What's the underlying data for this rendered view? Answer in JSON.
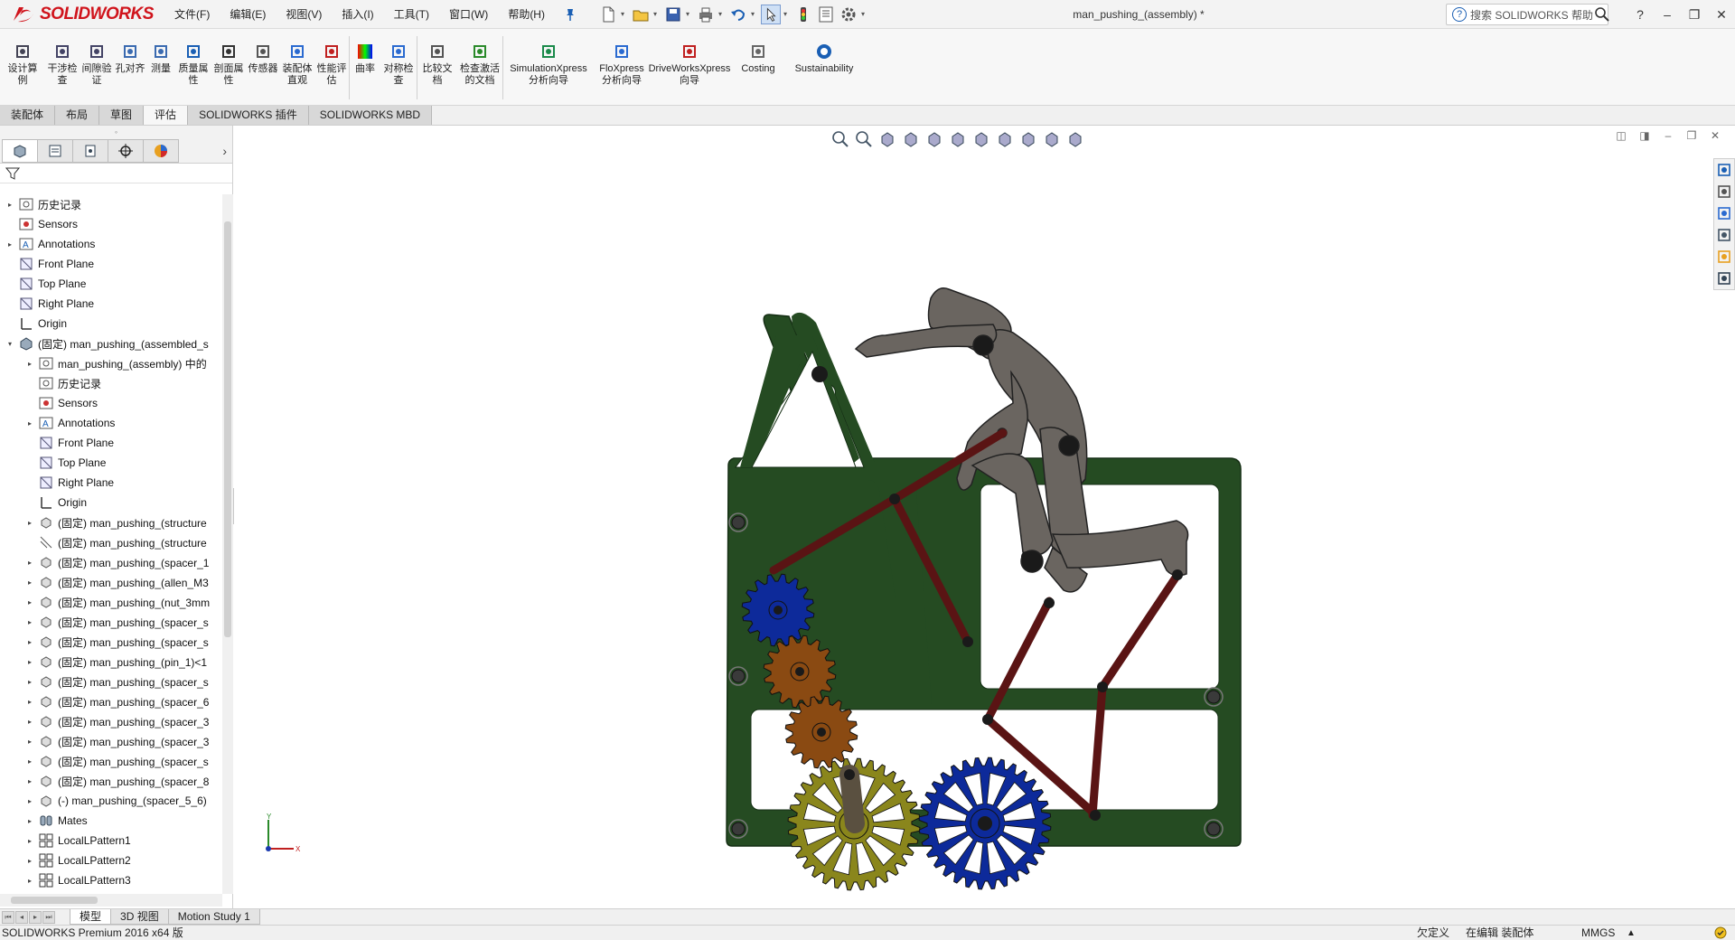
{
  "app": {
    "logo_text": "SOLIDWORKS",
    "document_title": "man_pushing_(assembly) *",
    "search_placeholder": "搜索 SOLIDWORKS 帮助"
  },
  "menu": [
    {
      "id": "file",
      "label": "文件(F)"
    },
    {
      "id": "edit",
      "label": "编辑(E)"
    },
    {
      "id": "view",
      "label": "视图(V)"
    },
    {
      "id": "insert",
      "label": "插入(I)"
    },
    {
      "id": "tools",
      "label": "工具(T)"
    },
    {
      "id": "window",
      "label": "窗口(W)"
    },
    {
      "id": "help",
      "label": "帮助(H)"
    }
  ],
  "quick_tools": [
    "new-file-icon",
    "open-file-icon",
    "save-icon",
    "print-icon",
    "undo-icon",
    "select-arrow-icon",
    "rebuild-icon",
    "file-properties-icon",
    "options-icon"
  ],
  "window_buttons": {
    "help": "?",
    "minimize": "–",
    "restore": "❐",
    "close": "✕"
  },
  "commands": [
    {
      "id": "design-study",
      "label": "设计算\n例",
      "icon": "design-study-icon"
    },
    {
      "id": "interference",
      "label": "干涉检\n查",
      "icon": "interference-icon"
    },
    {
      "id": "clearance",
      "label": "间隙验\n证",
      "icon": "clearance-icon"
    },
    {
      "id": "hole-align",
      "label": "孔对齐",
      "icon": "hole-align-icon"
    },
    {
      "id": "measure",
      "label": "测量",
      "icon": "measure-icon"
    },
    {
      "id": "mass-props",
      "label": "质量属\n性",
      "icon": "mass-properties-icon"
    },
    {
      "id": "section-props",
      "label": "剖面属\n性",
      "icon": "section-properties-icon"
    },
    {
      "id": "sensor",
      "label": "传感器",
      "icon": "sensor-icon"
    },
    {
      "id": "assembly-visual",
      "label": "装配体\n直观",
      "icon": "assembly-visualization-icon"
    },
    {
      "id": "performance",
      "label": "性能评\n估",
      "icon": "performance-icon"
    },
    {
      "id": "curvature",
      "label": "曲率",
      "icon": "curvature-icon"
    },
    {
      "id": "symmetry",
      "label": "对称检\n查",
      "icon": "symmetry-icon"
    },
    {
      "id": "compare",
      "label": "比较文\n档",
      "icon": "compare-icon"
    },
    {
      "id": "check-active",
      "label": "检查激活\n的文档",
      "icon": "check-active-icon"
    },
    {
      "id": "simxpress",
      "label": "SimulationXpress\n分析向导",
      "icon": "simulationxpress-icon"
    },
    {
      "id": "floxpress",
      "label": "FloXpress\n分析向导",
      "icon": "floxpress-icon"
    },
    {
      "id": "driveworks",
      "label": "DriveWorksXpress\n向导",
      "icon": "driveworks-icon"
    },
    {
      "id": "costing",
      "label": "Costing",
      "icon": "costing-icon"
    },
    {
      "id": "sustainability",
      "label": "Sustainability",
      "icon": "sustainability-icon"
    }
  ],
  "command_tabs": [
    {
      "label": "装配体",
      "active": false
    },
    {
      "label": "布局",
      "active": false
    },
    {
      "label": "草图",
      "active": false
    },
    {
      "label": "评估",
      "active": true
    },
    {
      "label": "SOLIDWORKS 插件",
      "active": false
    },
    {
      "label": "SOLIDWORKS MBD",
      "active": false
    }
  ],
  "panel_tabs": [
    "featuremanager-icon",
    "propertymanager-icon",
    "configurationmanager-icon",
    "dimxpert-icon",
    "display-manager-icon"
  ],
  "tree": [
    {
      "indent": 0,
      "expand": "▸",
      "icon": "history",
      "label": "历史记录"
    },
    {
      "indent": 0,
      "expand": "",
      "icon": "sensor",
      "label": "Sensors"
    },
    {
      "indent": 0,
      "expand": "▸",
      "icon": "annotation",
      "label": "Annotations"
    },
    {
      "indent": 0,
      "expand": "",
      "icon": "plane",
      "label": "Front Plane"
    },
    {
      "indent": 0,
      "expand": "",
      "icon": "plane",
      "label": "Top Plane"
    },
    {
      "indent": 0,
      "expand": "",
      "icon": "plane",
      "label": "Right Plane"
    },
    {
      "indent": 0,
      "expand": "",
      "icon": "origin",
      "label": "Origin"
    },
    {
      "indent": 0,
      "expand": "▾",
      "icon": "assembly",
      "label": "(固定) man_pushing_(assembled_s"
    },
    {
      "indent": 1,
      "expand": "▸",
      "icon": "history",
      "label": "man_pushing_(assembly) 中的"
    },
    {
      "indent": 1,
      "expand": "",
      "icon": "history",
      "label": "历史记录"
    },
    {
      "indent": 1,
      "expand": "",
      "icon": "sensor",
      "label": "Sensors"
    },
    {
      "indent": 1,
      "expand": "▸",
      "icon": "annotation",
      "label": "Annotations"
    },
    {
      "indent": 1,
      "expand": "",
      "icon": "plane",
      "label": "Front Plane"
    },
    {
      "indent": 1,
      "expand": "",
      "icon": "plane",
      "label": "Top Plane"
    },
    {
      "indent": 1,
      "expand": "",
      "icon": "plane",
      "label": "Right Plane"
    },
    {
      "indent": 1,
      "expand": "",
      "icon": "origin",
      "label": "Origin"
    },
    {
      "indent": 1,
      "expand": "▸",
      "icon": "part",
      "label": "(固定) man_pushing_(structure"
    },
    {
      "indent": 1,
      "expand": "",
      "icon": "sketch",
      "label": "(固定) man_pushing_(structure"
    },
    {
      "indent": 1,
      "expand": "▸",
      "icon": "part",
      "label": "(固定) man_pushing_(spacer_1"
    },
    {
      "indent": 1,
      "expand": "▸",
      "icon": "part",
      "label": "(固定) man_pushing_(allen_M3"
    },
    {
      "indent": 1,
      "expand": "▸",
      "icon": "part",
      "label": "(固定) man_pushing_(nut_3mm"
    },
    {
      "indent": 1,
      "expand": "▸",
      "icon": "part",
      "label": "(固定) man_pushing_(spacer_s"
    },
    {
      "indent": 1,
      "expand": "▸",
      "icon": "part",
      "label": "(固定) man_pushing_(spacer_s"
    },
    {
      "indent": 1,
      "expand": "▸",
      "icon": "part",
      "label": "(固定) man_pushing_(pin_1)<1"
    },
    {
      "indent": 1,
      "expand": "▸",
      "icon": "part",
      "label": "(固定) man_pushing_(spacer_s"
    },
    {
      "indent": 1,
      "expand": "▸",
      "icon": "part",
      "label": "(固定) man_pushing_(spacer_6"
    },
    {
      "indent": 1,
      "expand": "▸",
      "icon": "part",
      "label": "(固定) man_pushing_(spacer_3"
    },
    {
      "indent": 1,
      "expand": "▸",
      "icon": "part",
      "label": "(固定) man_pushing_(spacer_3"
    },
    {
      "indent": 1,
      "expand": "▸",
      "icon": "part",
      "label": "(固定) man_pushing_(spacer_s"
    },
    {
      "indent": 1,
      "expand": "▸",
      "icon": "part",
      "label": "(固定) man_pushing_(spacer_8"
    },
    {
      "indent": 1,
      "expand": "▸",
      "icon": "part",
      "label": "(-) man_pushing_(spacer_5_6)"
    },
    {
      "indent": 1,
      "expand": "▸",
      "icon": "mates",
      "label": "Mates"
    },
    {
      "indent": 1,
      "expand": "▸",
      "icon": "pattern",
      "label": "LocalLPattern1"
    },
    {
      "indent": 1,
      "expand": "▸",
      "icon": "pattern",
      "label": "LocalLPattern2"
    },
    {
      "indent": 1,
      "expand": "▸",
      "icon": "pattern",
      "label": "LocalLPattern3"
    }
  ],
  "heads_up": [
    "zoom-to-fit-icon",
    "zoom-area-icon",
    "previous-view-icon",
    "section-view-icon",
    "dynamic-annotation-icon",
    "view-orientation-icon",
    "display-style-icon",
    "hide-show-icon",
    "edit-appearance-icon",
    "apply-scene-icon",
    "view-settings-icon"
  ],
  "task_pane": [
    "home-icon",
    "resources-icon",
    "design-library-icon",
    "file-explorer-icon",
    "appearances-icon",
    "custom-properties-icon"
  ],
  "triad": {
    "x_label": "X",
    "y_label": "Y"
  },
  "bottom_tabs": [
    {
      "label": "模型",
      "active": true
    },
    {
      "label": "3D 视图",
      "active": false
    },
    {
      "label": "Motion Study 1",
      "active": false
    }
  ],
  "status": {
    "product": "SOLIDWORKS Premium 2016 x64 版",
    "definition": "欠定义",
    "editing": "在编辑 装配体",
    "units": "MMGS",
    "units_arrow": "▲"
  },
  "colors": {
    "frame": "#254b22",
    "link": "#5a1414",
    "gear_blue": "#0d2a9a",
    "gear_orange": "#8a4a12",
    "gear_olive": "#8a861c",
    "figure": "#6a6560",
    "brand_red": "#d0141c"
  }
}
